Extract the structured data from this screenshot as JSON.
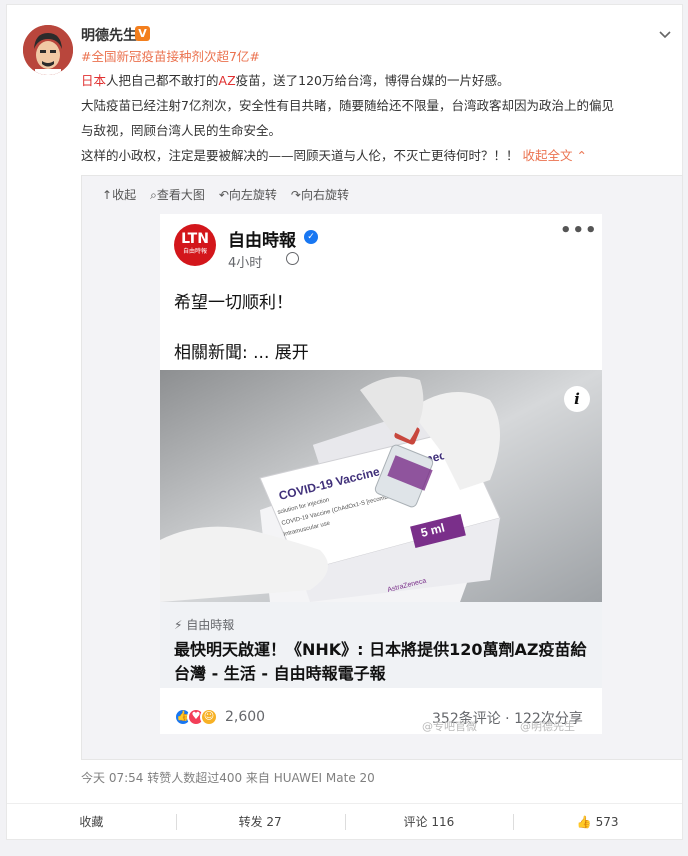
{
  "post": {
    "username": "明德先生",
    "verified_badge": "V",
    "topic": "#全国新冠疫苗接种剂次超7亿#",
    "line1_red1": "日本",
    "line1_a": "人把自己都不敢打的",
    "line1_red2": "AZ",
    "line1_b": "疫苗，送了120万给台湾，博得台媒的一片好感。",
    "line2": "大陆疫苗已经注射7亿剂次，安全性有目共睹，随要随给还不限量，台湾政客却因为政治上的偏见",
    "line3": "与敌视，罔顾台湾人民的生命安全。",
    "line4": "这样的小政权，注定是要被解决的——罔顾天道与人伦，不灭亡更待何时？！！",
    "collapse_link": "收起全文",
    "meta": "今天 07:54 转赞人数超过400  来自 HUAWEI Mate 20"
  },
  "media_toolbar": {
    "collapse": "收起",
    "view_large": "查看大图",
    "rotate_left": "向左旋转",
    "rotate_right": "向右旋转"
  },
  "fb_post": {
    "logo_text": "LTN",
    "logo_sub": "自由時報",
    "page_name": "自由時報",
    "time": "4小时",
    "text1": "希望一切顺利！",
    "related_label": "相關新聞: ...",
    "expand": "展开",
    "link_source": "自由時報",
    "headline": "最快明天啟運！《NHK》: 日本將提供120萬劑AZ疫苗給台灣 - 生活 - 自由時報電子報",
    "reactions_count": "2,600",
    "comments": "352条评论",
    "shares": "122次分享",
    "watermark1": "@专吧官微",
    "watermark2": "@明德先生",
    "vial_box": {
      "line1": "COVID-19 Vaccine AstraZeneca",
      "line2": "solution for injection",
      "line3": "COVID-19 Vaccine (ChAdOx1-S [recombinant])",
      "line4": "Intramuscular use",
      "dose": "5 ml",
      "brand": "AstraZeneca"
    }
  },
  "actions": {
    "favorite": "收藏",
    "repost": "转发 27",
    "comment": "评论 116",
    "like": "573"
  }
}
